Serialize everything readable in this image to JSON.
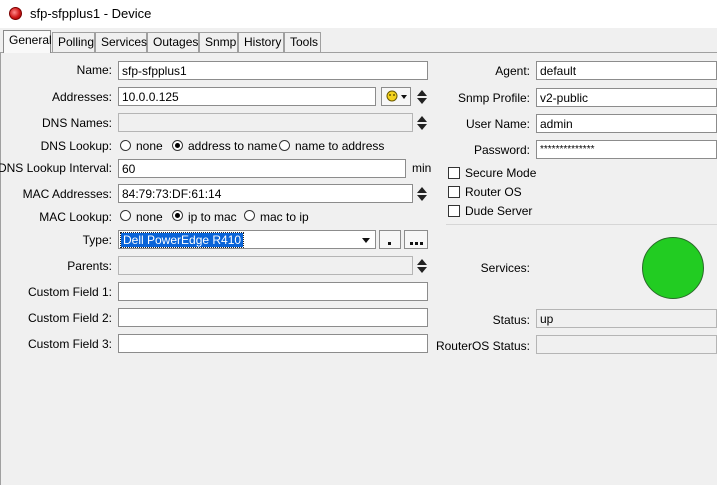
{
  "window": {
    "title": "sfp-sfpplus1 - Device"
  },
  "tabs": [
    {
      "label": "General"
    },
    {
      "label": "Polling"
    },
    {
      "label": "Services"
    },
    {
      "label": "Outages"
    },
    {
      "label": "Snmp"
    },
    {
      "label": "History"
    },
    {
      "label": "Tools"
    }
  ],
  "left": {
    "name_label": "Name:",
    "name_value": "sfp-sfpplus1",
    "addresses_label": "Addresses:",
    "addresses_value": "10.0.0.125",
    "dns_names_label": "DNS Names:",
    "dns_names_value": "",
    "dns_lookup_label": "DNS Lookup:",
    "dns_lookup_options": [
      "none",
      "address to name",
      "name to address"
    ],
    "dns_lookup_selected": "address to name",
    "dns_lookup_interval_label": "DNS Lookup Interval:",
    "dns_lookup_interval_value": "60",
    "dns_lookup_interval_unit": "min",
    "mac_addresses_label": "MAC Addresses:",
    "mac_addresses_value": "84:79:73:DF:61:14",
    "mac_lookup_label": "MAC Lookup:",
    "mac_lookup_options": [
      "none",
      "ip to mac",
      "mac to ip"
    ],
    "mac_lookup_selected": "ip to mac",
    "type_label": "Type:",
    "type_value": "Dell PowerEdge R410",
    "parents_label": "Parents:",
    "parents_value": "",
    "custom1_label": "Custom Field 1:",
    "custom1_value": "",
    "custom2_label": "Custom Field 2:",
    "custom2_value": "",
    "custom3_label": "Custom Field 3:",
    "custom3_value": ""
  },
  "right": {
    "agent_label": "Agent:",
    "agent_value": "default",
    "snmp_profile_label": "Snmp Profile:",
    "snmp_profile_value": "v2-public",
    "user_name_label": "User Name:",
    "user_name_value": "admin",
    "password_label": "Password:",
    "password_value": "**************",
    "secure_mode_label": "Secure Mode",
    "router_os_label": "Router OS",
    "dude_server_label": "Dude Server",
    "services_label": "Services:",
    "services_color": "#22cc22",
    "status_label": "Status:",
    "status_value": "up",
    "routeros_status_label": "RouterOS Status:",
    "routeros_status_value": ""
  },
  "icons": {
    "address_picker": "address-book-icon"
  },
  "colors": {
    "selection": "#0a64d8",
    "status_up": "#22cc22"
  }
}
